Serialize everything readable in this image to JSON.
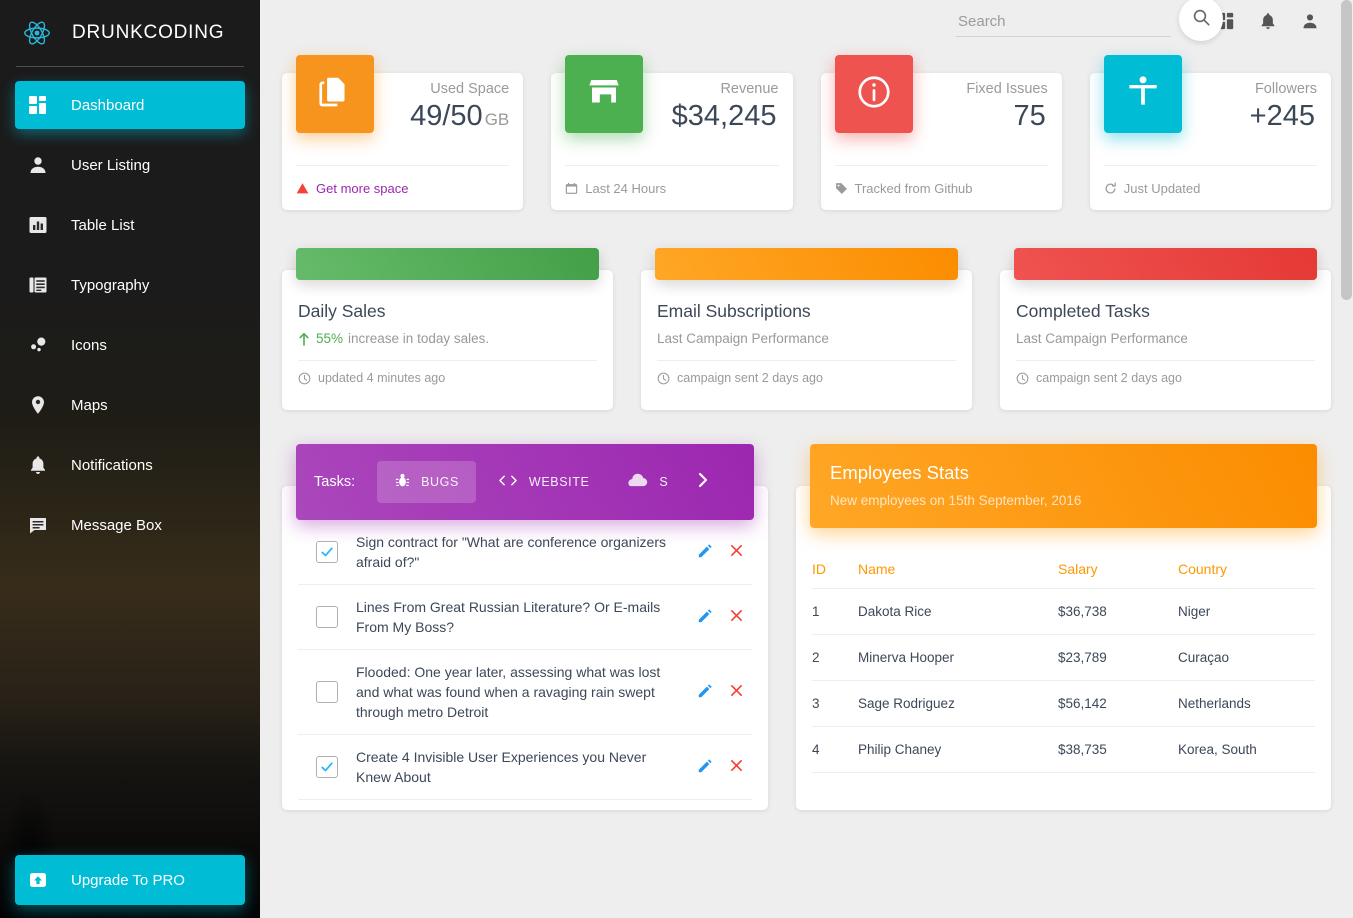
{
  "sidebar": {
    "brand": "DRUNKCODING",
    "brand_icon": "react-atom-icon",
    "items": [
      {
        "label": "Dashboard",
        "icon": "dashboard-grid-icon",
        "active": true
      },
      {
        "label": "User Listing",
        "icon": "person-icon",
        "active": false
      },
      {
        "label": "Table List",
        "icon": "bar-chart-icon",
        "active": false
      },
      {
        "label": "Typography",
        "icon": "text-document-icon",
        "active": false
      },
      {
        "label": "Icons",
        "icon": "bubbles-icon",
        "active": false
      },
      {
        "label": "Maps",
        "icon": "map-pin-icon",
        "active": false
      },
      {
        "label": "Notifications",
        "icon": "bell-icon",
        "active": false
      },
      {
        "label": "Message Box",
        "icon": "message-icon",
        "active": false
      }
    ],
    "upgrade": {
      "label": "Upgrade To PRO",
      "icon": "upload-box-icon"
    },
    "accent_color": "#00bcd4"
  },
  "topbar": {
    "search": {
      "value": "",
      "placeholder": "Search"
    },
    "search_button_icon": "search-icon",
    "icons": [
      {
        "name": "dashboard-grid-icon"
      },
      {
        "name": "bell-icon"
      },
      {
        "name": "person-icon"
      }
    ]
  },
  "stats": [
    {
      "label": "Used Space",
      "value": "49/50",
      "unit": "GB",
      "icon": "file-copy-icon",
      "color": "#f7941e",
      "footer": "Get more space",
      "footer_icon": "warning-triangle-icon",
      "footer_link": true
    },
    {
      "label": "Revenue",
      "value": "$34,245",
      "unit": "",
      "icon": "store-icon",
      "color": "#4caf50",
      "footer": "Last 24 Hours",
      "footer_icon": "calendar-icon",
      "footer_link": false
    },
    {
      "label": "Fixed Issues",
      "value": "75",
      "unit": "",
      "icon": "info-circle-icon",
      "color": "#ef5350",
      "footer": "Tracked from Github",
      "footer_icon": "tag-icon",
      "footer_link": false
    },
    {
      "label": "Followers",
      "value": "+245",
      "unit": "",
      "icon": "accessibility-icon",
      "color": "#00bcd4",
      "footer": "Just Updated",
      "footer_icon": "refresh-icon",
      "footer_link": false
    }
  ],
  "charts": [
    {
      "title": "Daily Sales",
      "highlight": "55%",
      "subtitle": "increase in today sales.",
      "arrow_icon": "arrow-up-icon",
      "footer": "updated 4 minutes ago",
      "footer_icon": "clock-icon",
      "banner_color": "#4caf50"
    },
    {
      "title": "Email Subscriptions",
      "highlight": "",
      "subtitle": "Last Campaign Performance",
      "arrow_icon": "",
      "footer": "campaign sent 2 days ago",
      "footer_icon": "clock-icon",
      "banner_color": "#ff9800"
    },
    {
      "title": "Completed Tasks",
      "highlight": "",
      "subtitle": "Last Campaign Performance",
      "arrow_icon": "",
      "footer": "campaign sent 2 days ago",
      "footer_icon": "clock-icon",
      "banner_color": "#ef5350"
    }
  ],
  "tasks": {
    "header_label": "Tasks:",
    "tabs": [
      {
        "label": "BUGS",
        "icon": "bug-icon",
        "active": true
      },
      {
        "label": "WEBSITE",
        "icon": "code-icon",
        "active": false
      },
      {
        "label": "S",
        "icon": "cloud-icon",
        "active": false
      }
    ],
    "next_icon": "chevron-right-icon",
    "items": [
      {
        "checked": true,
        "text": "Sign contract for \"What are conference organizers afraid of?\""
      },
      {
        "checked": false,
        "text": "Lines From Great Russian Literature? Or E-mails From My Boss?"
      },
      {
        "checked": false,
        "text": "Flooded: One year later, assessing what was lost and what was found when a ravaging rain swept through metro Detroit"
      },
      {
        "checked": true,
        "text": "Create 4 Invisible User Experiences you Never Knew About"
      }
    ],
    "edit_icon": "pencil-icon",
    "delete_icon": "close-x-icon"
  },
  "employees": {
    "title": "Employees Stats",
    "subtitle": "New employees on 15th September, 2016",
    "columns": [
      "ID",
      "Name",
      "Salary",
      "Country"
    ],
    "rows": [
      {
        "id": "1",
        "name": "Dakota Rice",
        "salary": "$36,738",
        "country": "Niger"
      },
      {
        "id": "2",
        "name": "Minerva Hooper",
        "salary": "$23,789",
        "country": "Curaçao"
      },
      {
        "id": "3",
        "name": "Sage Rodriguez",
        "salary": "$56,142",
        "country": "Netherlands"
      },
      {
        "id": "4",
        "name": "Philip Chaney",
        "salary": "$38,735",
        "country": "Korea, South"
      }
    ]
  }
}
